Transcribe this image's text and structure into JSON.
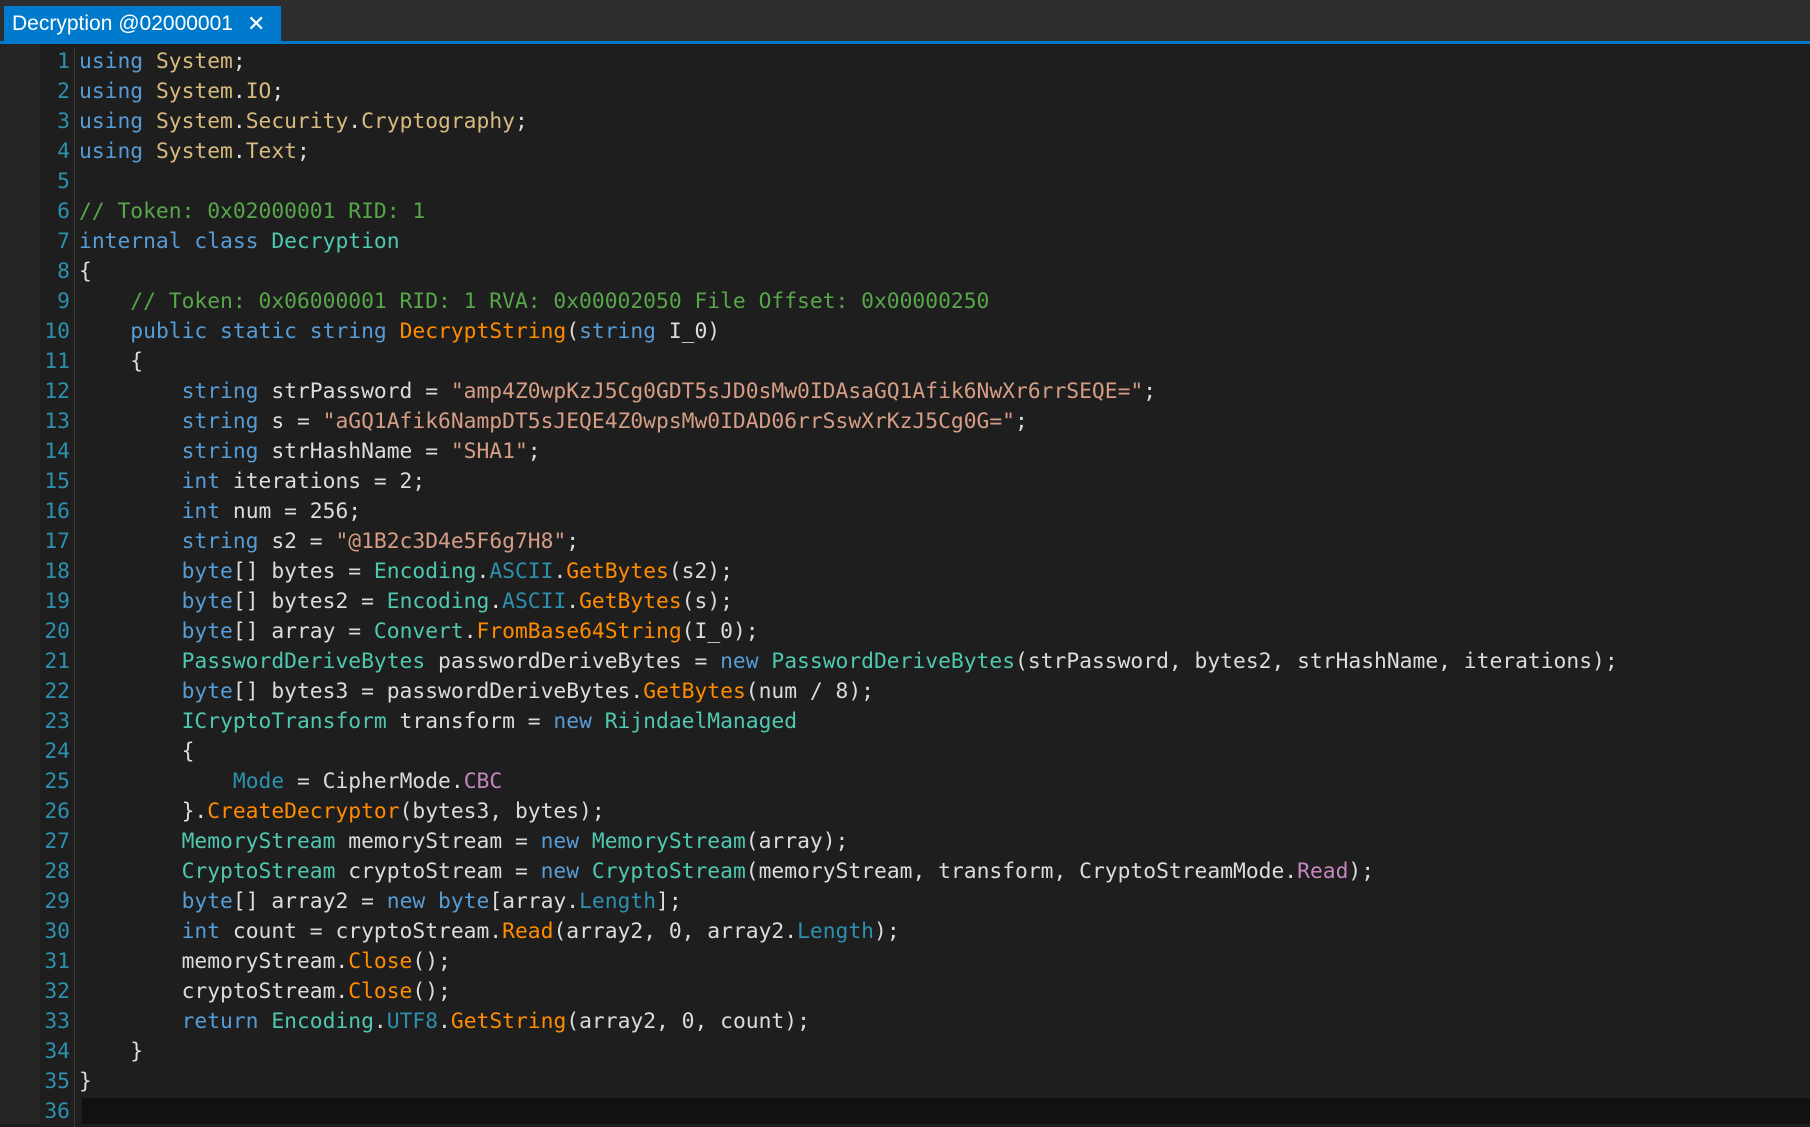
{
  "tab": {
    "title": "Decryption @02000001",
    "close_glyph": "✕"
  },
  "colors": {
    "kw": "#569cd6",
    "type": "#4ec9b0",
    "ns": "#d7ba7d",
    "method": "#ff8c00",
    "string": "#d69d85",
    "comment": "#57a64a",
    "prop": "#2b91af",
    "enum": "#b8d7a3",
    "enummember": "#c586c0",
    "text": "#dcdcdc",
    "linenum": "#2b91af"
  },
  "lines": [
    [
      [
        "kw",
        "using"
      ],
      [
        "t",
        " "
      ],
      [
        "ns",
        "System"
      ],
      [
        "t",
        ";"
      ]
    ],
    [
      [
        "kw",
        "using"
      ],
      [
        "t",
        " "
      ],
      [
        "ns",
        "System"
      ],
      [
        "t",
        "."
      ],
      [
        "ns",
        "IO"
      ],
      [
        "t",
        ";"
      ]
    ],
    [
      [
        "kw",
        "using"
      ],
      [
        "t",
        " "
      ],
      [
        "ns",
        "System"
      ],
      [
        "t",
        "."
      ],
      [
        "ns",
        "Security"
      ],
      [
        "t",
        "."
      ],
      [
        "ns",
        "Cryptography"
      ],
      [
        "t",
        ";"
      ]
    ],
    [
      [
        "kw",
        "using"
      ],
      [
        "t",
        " "
      ],
      [
        "ns",
        "System"
      ],
      [
        "t",
        "."
      ],
      [
        "ns",
        "Text"
      ],
      [
        "t",
        ";"
      ]
    ],
    [],
    [
      [
        "comment",
        "// Token: 0x02000001 RID: 1"
      ]
    ],
    [
      [
        "kw",
        "internal class"
      ],
      [
        "t",
        " "
      ],
      [
        "type",
        "Decryption"
      ]
    ],
    [
      [
        "t",
        "{"
      ]
    ],
    [
      [
        "t",
        "    "
      ],
      [
        "comment",
        "// Token: 0x06000001 RID: 1 RVA: 0x00002050 File Offset: 0x00000250"
      ]
    ],
    [
      [
        "t",
        "    "
      ],
      [
        "kw",
        "public static string"
      ],
      [
        "t",
        " "
      ],
      [
        "method",
        "DecryptString"
      ],
      [
        "t",
        "("
      ],
      [
        "kw",
        "string"
      ],
      [
        "t",
        " I_0)"
      ]
    ],
    [
      [
        "t",
        "    {"
      ]
    ],
    [
      [
        "t",
        "        "
      ],
      [
        "kw",
        "string"
      ],
      [
        "t",
        " strPassword = "
      ],
      [
        "string",
        "\"amp4Z0wpKzJ5Cg0GDT5sJD0sMw0IDAsaGQ1Afik6NwXr6rrSEQE=\""
      ],
      [
        "t",
        ";"
      ]
    ],
    [
      [
        "t",
        "        "
      ],
      [
        "kw",
        "string"
      ],
      [
        "t",
        " s = "
      ],
      [
        "string",
        "\"aGQ1Afik6NampDT5sJEQE4Z0wpsMw0IDAD06rrSswXrKzJ5Cg0G=\""
      ],
      [
        "t",
        ";"
      ]
    ],
    [
      [
        "t",
        "        "
      ],
      [
        "kw",
        "string"
      ],
      [
        "t",
        " strHashName = "
      ],
      [
        "string",
        "\"SHA1\""
      ],
      [
        "t",
        ";"
      ]
    ],
    [
      [
        "t",
        "        "
      ],
      [
        "kw",
        "int"
      ],
      [
        "t",
        " iterations = 2;"
      ]
    ],
    [
      [
        "t",
        "        "
      ],
      [
        "kw",
        "int"
      ],
      [
        "t",
        " num = 256;"
      ]
    ],
    [
      [
        "t",
        "        "
      ],
      [
        "kw",
        "string"
      ],
      [
        "t",
        " s2 = "
      ],
      [
        "string",
        "\"@1B2c3D4e5F6g7H8\""
      ],
      [
        "t",
        ";"
      ]
    ],
    [
      [
        "t",
        "        "
      ],
      [
        "kw",
        "byte"
      ],
      [
        "t",
        "[] bytes = "
      ],
      [
        "type",
        "Encoding"
      ],
      [
        "t",
        "."
      ],
      [
        "prop",
        "ASCII"
      ],
      [
        "t",
        "."
      ],
      [
        "method",
        "GetBytes"
      ],
      [
        "t",
        "(s2);"
      ]
    ],
    [
      [
        "t",
        "        "
      ],
      [
        "kw",
        "byte"
      ],
      [
        "t",
        "[] bytes2 = "
      ],
      [
        "type",
        "Encoding"
      ],
      [
        "t",
        "."
      ],
      [
        "prop",
        "ASCII"
      ],
      [
        "t",
        "."
      ],
      [
        "method",
        "GetBytes"
      ],
      [
        "t",
        "(s);"
      ]
    ],
    [
      [
        "t",
        "        "
      ],
      [
        "kw",
        "byte"
      ],
      [
        "t",
        "[] array = "
      ],
      [
        "type",
        "Convert"
      ],
      [
        "t",
        "."
      ],
      [
        "method",
        "FromBase64String"
      ],
      [
        "t",
        "(I_0);"
      ]
    ],
    [
      [
        "t",
        "        "
      ],
      [
        "type",
        "PasswordDeriveBytes"
      ],
      [
        "t",
        " passwordDeriveBytes = "
      ],
      [
        "kw",
        "new"
      ],
      [
        "t",
        " "
      ],
      [
        "type",
        "PasswordDeriveBytes"
      ],
      [
        "t",
        "(strPassword, bytes2, strHashName, iterations);"
      ]
    ],
    [
      [
        "t",
        "        "
      ],
      [
        "kw",
        "byte"
      ],
      [
        "t",
        "[] bytes3 = passwordDeriveBytes."
      ],
      [
        "method",
        "GetBytes"
      ],
      [
        "t",
        "(num / 8);"
      ]
    ],
    [
      [
        "t",
        "        "
      ],
      [
        "type",
        "ICryptoTransform"
      ],
      [
        "t",
        " transform = "
      ],
      [
        "kw",
        "new"
      ],
      [
        "t",
        " "
      ],
      [
        "type",
        "RijndaelManaged"
      ]
    ],
    [
      [
        "t",
        "        {"
      ]
    ],
    [
      [
        "t",
        "            "
      ],
      [
        "prop",
        "Mode"
      ],
      [
        "t",
        " = CipherMode."
      ],
      [
        "enummember",
        "CBC"
      ]
    ],
    [
      [
        "t",
        "        }."
      ],
      [
        "method",
        "CreateDecryptor"
      ],
      [
        "t",
        "(bytes3, bytes);"
      ]
    ],
    [
      [
        "t",
        "        "
      ],
      [
        "type",
        "MemoryStream"
      ],
      [
        "t",
        " memoryStream = "
      ],
      [
        "kw",
        "new"
      ],
      [
        "t",
        " "
      ],
      [
        "type",
        "MemoryStream"
      ],
      [
        "t",
        "(array);"
      ]
    ],
    [
      [
        "t",
        "        "
      ],
      [
        "type",
        "CryptoStream"
      ],
      [
        "t",
        " cryptoStream = "
      ],
      [
        "kw",
        "new"
      ],
      [
        "t",
        " "
      ],
      [
        "type",
        "CryptoStream"
      ],
      [
        "t",
        "(memoryStream, transform, CryptoStreamMode."
      ],
      [
        "enummember",
        "Read"
      ],
      [
        "t",
        ");"
      ]
    ],
    [
      [
        "t",
        "        "
      ],
      [
        "kw",
        "byte"
      ],
      [
        "t",
        "[] array2 = "
      ],
      [
        "kw",
        "new byte"
      ],
      [
        "t",
        "[array."
      ],
      [
        "prop",
        "Length"
      ],
      [
        "t",
        "];"
      ]
    ],
    [
      [
        "t",
        "        "
      ],
      [
        "kw",
        "int"
      ],
      [
        "t",
        " count = cryptoStream."
      ],
      [
        "method",
        "Read"
      ],
      [
        "t",
        "(array2, 0, array2."
      ],
      [
        "prop",
        "Length"
      ],
      [
        "t",
        ");"
      ]
    ],
    [
      [
        "t",
        "        memoryStream."
      ],
      [
        "method",
        "Close"
      ],
      [
        "t",
        "();"
      ]
    ],
    [
      [
        "t",
        "        cryptoStream."
      ],
      [
        "method",
        "Close"
      ],
      [
        "t",
        "();"
      ]
    ],
    [
      [
        "t",
        "        "
      ],
      [
        "kw",
        "return"
      ],
      [
        "t",
        " "
      ],
      [
        "type",
        "Encoding"
      ],
      [
        "t",
        "."
      ],
      [
        "prop",
        "UTF8"
      ],
      [
        "t",
        "."
      ],
      [
        "method",
        "GetString"
      ],
      [
        "t",
        "(array2, 0, count);"
      ]
    ],
    [
      [
        "t",
        "    }"
      ]
    ],
    [
      [
        "t",
        "}"
      ]
    ],
    []
  ]
}
